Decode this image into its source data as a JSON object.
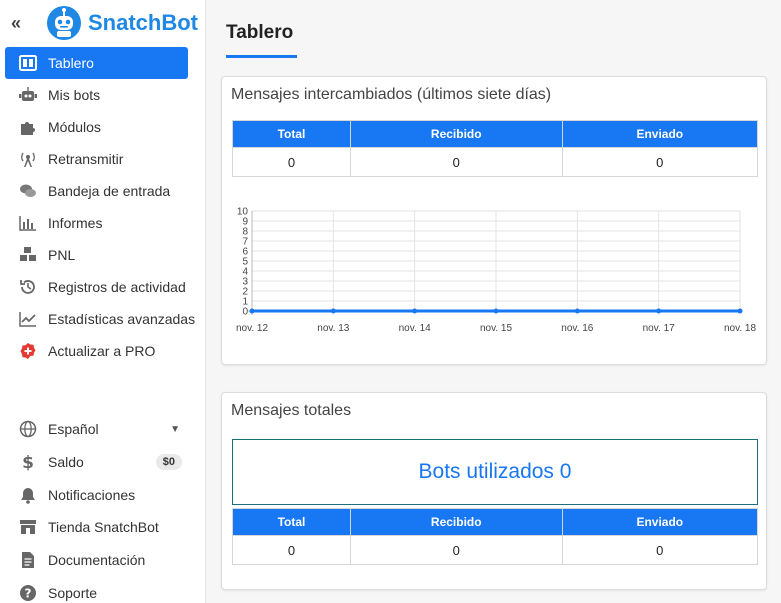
{
  "brand": {
    "name": "SnatchBot",
    "collapse_icon": "«"
  },
  "colors": {
    "accent": "#1877f2",
    "pro": "#e53935"
  },
  "sidebar": {
    "items": [
      {
        "label": "Tablero",
        "icon": "dashboard-icon",
        "active": true
      },
      {
        "label": "Mis bots",
        "icon": "robot-icon"
      },
      {
        "label": "Módulos",
        "icon": "puzzle-icon"
      },
      {
        "label": "Retransmitir",
        "icon": "broadcast-icon"
      },
      {
        "label": "Bandeja de entrada",
        "icon": "chat-icon"
      },
      {
        "label": "Informes",
        "icon": "bar-chart-icon"
      },
      {
        "label": "PNL",
        "icon": "cubes-icon"
      },
      {
        "label": "Registros de actividad",
        "icon": "history-icon"
      },
      {
        "label": "Estadísticas avanzadas",
        "icon": "line-chart-icon"
      },
      {
        "label": "Actualizar a PRO",
        "icon": "plus-badge-icon"
      }
    ],
    "bottom": {
      "language": "Español",
      "balance_label": "Saldo",
      "balance_value": "$0",
      "notifications": "Notificaciones",
      "store": "Tienda SnatchBot",
      "docs": "Documentación",
      "support": "Soporte"
    }
  },
  "main": {
    "title": "Tablero",
    "messages_card": {
      "title": "Mensajes intercambiados (últimos siete días)",
      "headers": [
        "Total",
        "Recibido",
        "Enviado"
      ],
      "values": [
        "0",
        "0",
        "0"
      ]
    },
    "totals_card": {
      "title": "Mensajes totales",
      "bots_used": "Bots utilizados 0",
      "headers": [
        "Total",
        "Recibido",
        "Enviado"
      ],
      "values": [
        "0",
        "0",
        "0"
      ]
    }
  },
  "chart_data": {
    "type": "line",
    "categories": [
      "nov. 12",
      "nov. 13",
      "nov. 14",
      "nov. 15",
      "nov. 16",
      "nov. 17",
      "nov. 18"
    ],
    "series": [
      {
        "values": [
          0,
          0,
          0,
          0,
          0,
          0,
          0
        ]
      }
    ],
    "ylim": [
      0,
      10
    ],
    "yticks": [
      "0",
      "1",
      "2",
      "3",
      "4",
      "5",
      "6",
      "7",
      "8",
      "9",
      "10"
    ],
    "grid": true,
    "line_color": "#1877f2"
  }
}
